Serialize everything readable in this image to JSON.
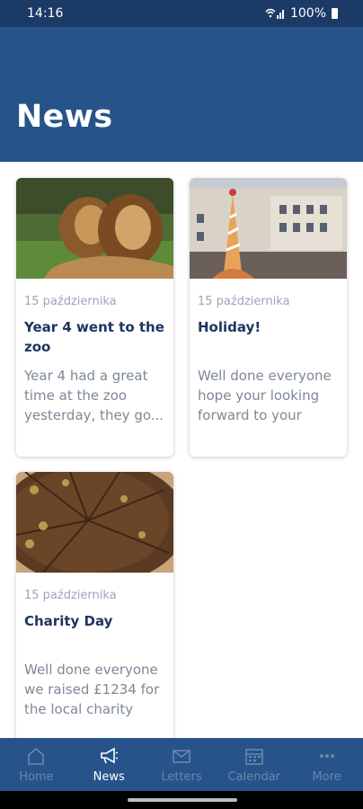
{
  "status": {
    "time": "14:16",
    "battery": "100%"
  },
  "header": {
    "title": "News"
  },
  "cards": [
    {
      "date": "15 października",
      "title": "Year 4 went to the zoo",
      "excerpt": "Year 4 had a great time at the zoo yesterday, they go..."
    },
    {
      "date": "15 października",
      "title": "Holiday!",
      "excerpt": "Well done everyone hope your looking forward to your res..."
    },
    {
      "date": "15 października",
      "title": "Charity Day",
      "excerpt": "Well done everyone we raised £1234 for the local charity"
    }
  ],
  "nav": {
    "items": [
      {
        "label": "Home",
        "icon": "home-icon"
      },
      {
        "label": "News",
        "icon": "megaphone-icon"
      },
      {
        "label": "Letters",
        "icon": "envelope-icon"
      },
      {
        "label": "Calendar",
        "icon": "calendar-icon"
      },
      {
        "label": "More",
        "icon": "more-dots-icon"
      }
    ],
    "active": "News"
  },
  "colors": {
    "header": "#26538a",
    "status_bar": "#1c3a66",
    "title_text": "#1e3560",
    "nav_inactive": "#6b86ac"
  }
}
